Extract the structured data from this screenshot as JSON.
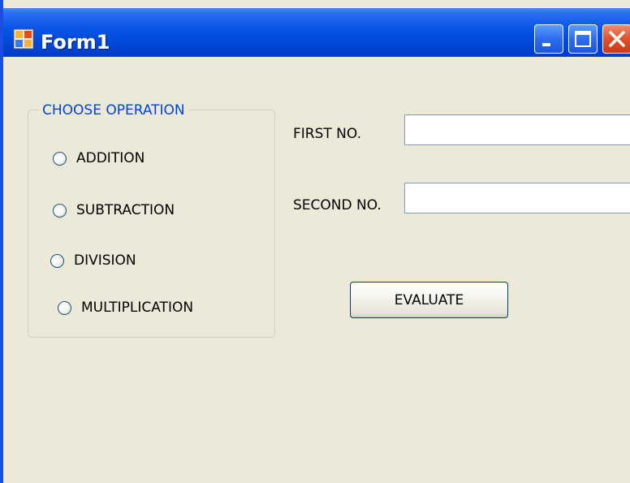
{
  "window": {
    "title": "Form1",
    "icon": "form-window-icon",
    "controls": [
      "minimize-icon",
      "maximize-icon",
      "close-icon"
    ],
    "colors": {
      "titlebar": "#0A56E8",
      "client_area": "#ECE9D8",
      "close_button": "#E0502A",
      "group_title": "#0046D5"
    }
  },
  "operation_group": {
    "title": "CHOOSE OPERATION",
    "options": [
      {
        "label": "ADDITION",
        "selected": false
      },
      {
        "label": "SUBTRACTION",
        "selected": false
      },
      {
        "label": "DIVISION",
        "selected": false
      },
      {
        "label": "MULTIPLICATION",
        "selected": false
      }
    ]
  },
  "fields": {
    "first": {
      "label": "FIRST NO.",
      "value": ""
    },
    "second": {
      "label": "SECOND NO.",
      "value": ""
    }
  },
  "actions": {
    "evaluate_label": "EVALUATE"
  }
}
